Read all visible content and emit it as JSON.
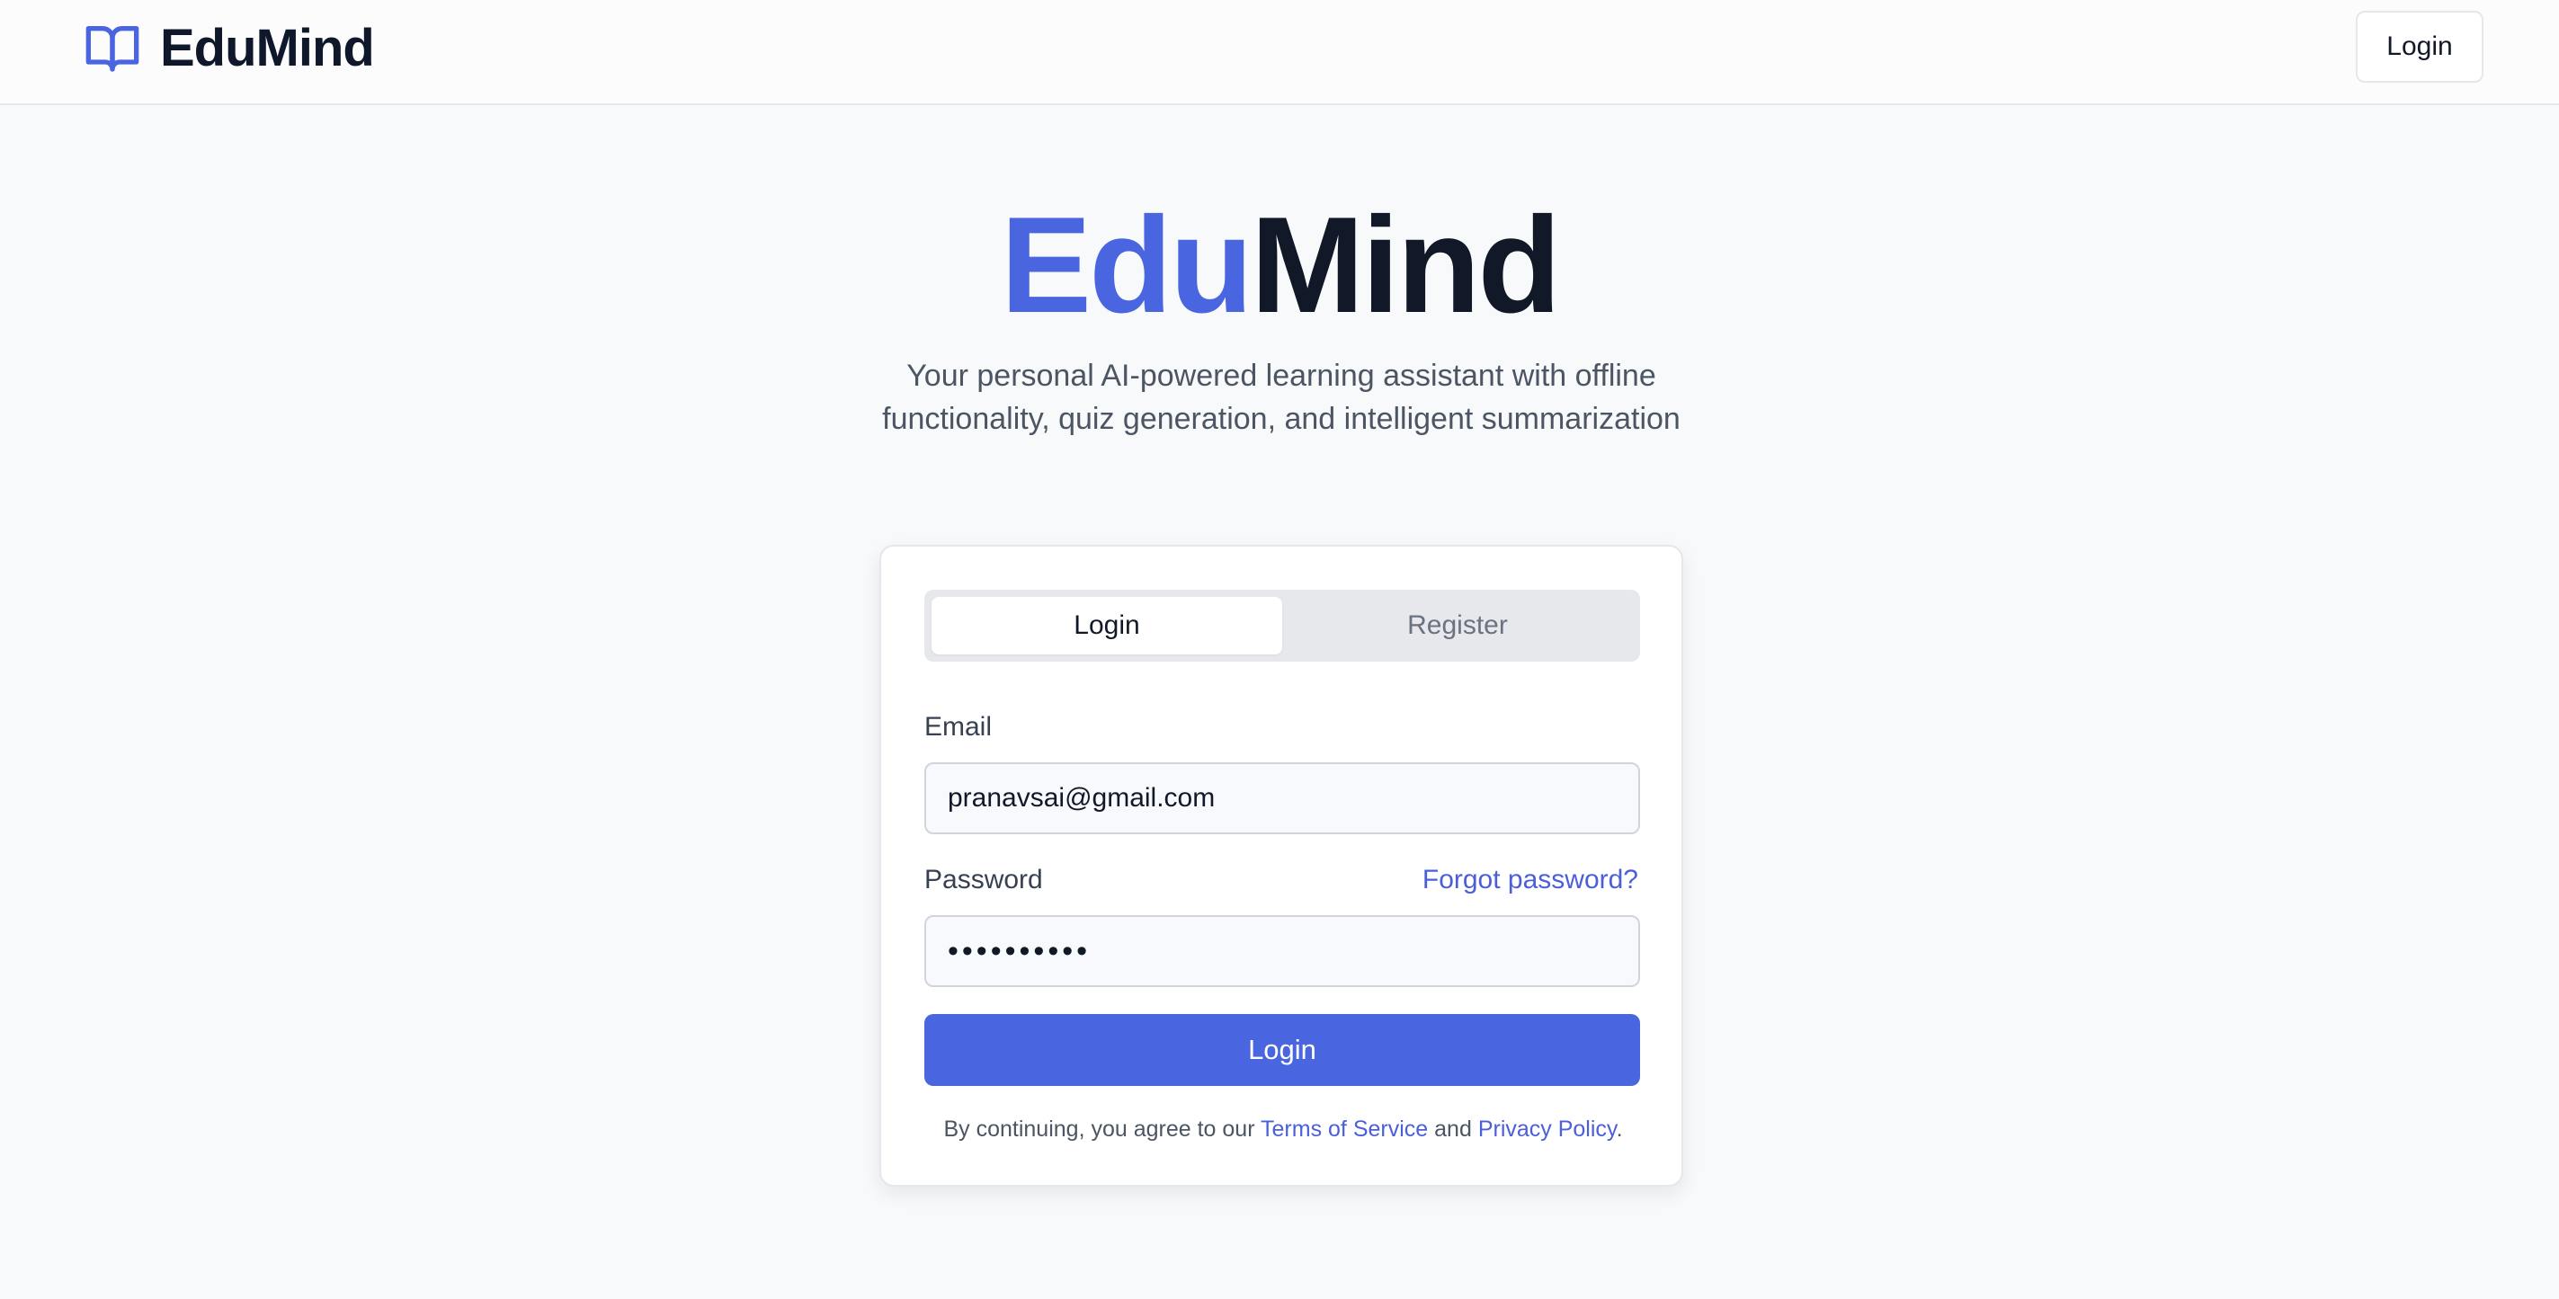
{
  "header": {
    "brand": "EduMind",
    "brand_icon": "open-book-icon",
    "login_button": "Login"
  },
  "hero": {
    "title_part1": "Edu",
    "title_part2": "Mind",
    "subtitle": "Your personal AI-powered learning assistant with offline functionality, quiz generation, and intelligent summarization"
  },
  "auth": {
    "tabs": {
      "login": "Login",
      "register": "Register"
    },
    "email_label": "Email",
    "email_value": "pranavsai@gmail.com",
    "password_label": "Password",
    "forgot_password": "Forgot password?",
    "password_value": "••••••••••",
    "submit": "Login",
    "terms": {
      "prefix": "By continuing, you agree to our ",
      "tos": "Terms of Service",
      "middle": " and ",
      "privacy": "Privacy Policy",
      "suffix": "."
    }
  },
  "colors": {
    "accent": "#4a65e0",
    "background": "#f8f9fb",
    "text_dark": "#111827"
  }
}
